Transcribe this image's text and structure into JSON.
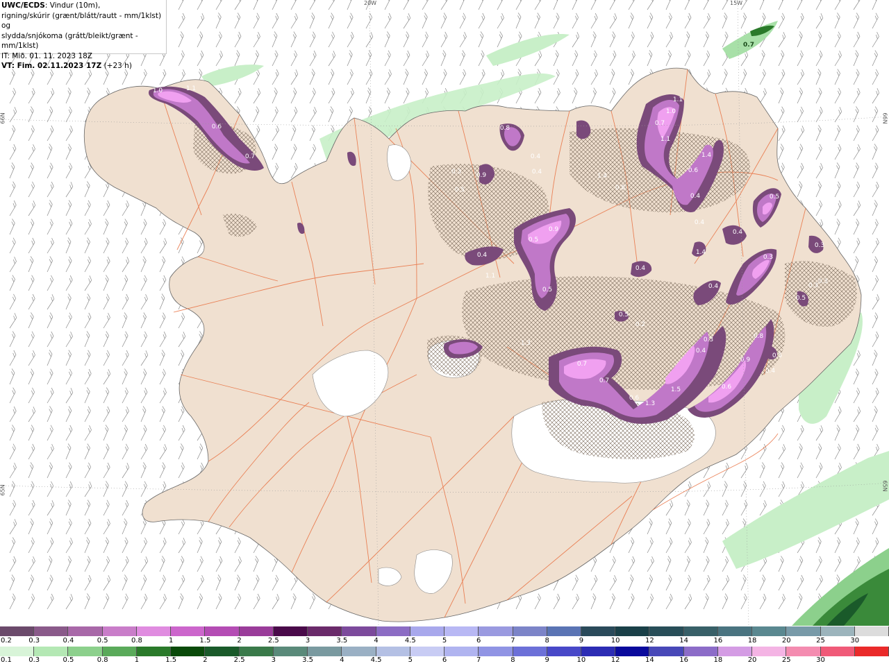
{
  "info": {
    "line1_bold": "UWC/ECDS",
    "line1_rest": ": Vindur (10m),",
    "line2": "rigning/skúrir (grænt/blátt/rautt - mm/1klst) og",
    "line3": "slydda/snjókoma (grátt/bleikt/grænt - mm/1klst)",
    "line4": "IT: Mið. 01. 11. 2023 18Z",
    "line5_bold": "VT: Fim. 02.11.2023 17Z",
    "line5_rest": " (+23 h)"
  },
  "grid_labels": {
    "lon_20w": "20W",
    "lon_15w": "15W",
    "lat_66n_left": "66N",
    "lat_66n_right": "66N",
    "lat_65n_left": "65N",
    "lat_65n_right": "65N"
  },
  "precip_labels": [
    "1.0",
    "1.1",
    "0.6",
    "0.7",
    "0.5",
    "0.3",
    "0.9",
    "0.5",
    "0.4",
    "0.4",
    "0.8",
    "1.1",
    "1.0",
    "0.7",
    "1.1",
    "1.4",
    "0.6",
    "0.4",
    "0.4",
    "1.4",
    "0.8",
    "0.9",
    "0.5",
    "0.4",
    "1.1",
    "0.5",
    "0.5",
    "0.4",
    "0.4",
    "1.4",
    "0.4",
    "0.3",
    "0.5",
    "0.2",
    "1.3",
    "0.7",
    "0.7",
    "0.6",
    "1.3",
    "1.5",
    "0.6",
    "0.9",
    "0.8",
    "0.3",
    "0.4",
    "0.5",
    "0.4",
    "0.3",
    "0.3",
    "0.3",
    "0.5",
    "0.7"
  ],
  "legend_top": {
    "colors": [
      "#6b4a6b",
      "#8a5a8a",
      "#a868a8",
      "#c97dc9",
      "#e08ce0",
      "#cc66cc",
      "#b44cb4",
      "#9a3c9a",
      "#4a0a4a",
      "#6a2a6a",
      "#7c4a9c",
      "#8c6cc4",
      "#a8a8ec",
      "#b8b8f4",
      "#9a9ae0",
      "#7c84c8",
      "#5a74b4",
      "#2a4a5a",
      "#1a4048",
      "#284e58",
      "#386068",
      "#4a7480",
      "#5a8890",
      "#789aa8",
      "#9cb4bc",
      "#dcdcdc"
    ],
    "labels": [
      "0.2",
      "0.3",
      "0.4",
      "0.5",
      "0.8",
      "1",
      "1.5",
      "2",
      "2.5",
      "3",
      "3.5",
      "4",
      "4.5",
      "5",
      "6",
      "7",
      "8",
      "9",
      "10",
      "12",
      "14",
      "16",
      "18",
      "20",
      "25",
      "30"
    ]
  },
  "legend_bottom": {
    "colors": [
      "#d8f4d8",
      "#b4e8b4",
      "#8cd08c",
      "#5aaa5a",
      "#2a7a2a",
      "#0a4a0a",
      "#1a5a2a",
      "#3a7a4a",
      "#5a8a7a",
      "#7a9aa0",
      "#9ab0c4",
      "#b4c0e4",
      "#c8ccf4",
      "#b0b4f0",
      "#9094e4",
      "#6c70d8",
      "#4848c8",
      "#2c2cb4",
      "#0a0a9c",
      "#4848b8",
      "#8c6cc8",
      "#d49ce4",
      "#f4b4e4",
      "#f48cb0",
      "#f05a78",
      "#ea2a2a"
    ],
    "labels": [
      "0.1",
      "0.3",
      "0.5",
      "0.8",
      "1",
      "1.5",
      "2",
      "2.5",
      "3",
      "3.5",
      "4",
      "4.5",
      "5",
      "6",
      "7",
      "8",
      "9",
      "10",
      "12",
      "14",
      "16",
      "18",
      "20",
      "25",
      "30"
    ]
  }
}
